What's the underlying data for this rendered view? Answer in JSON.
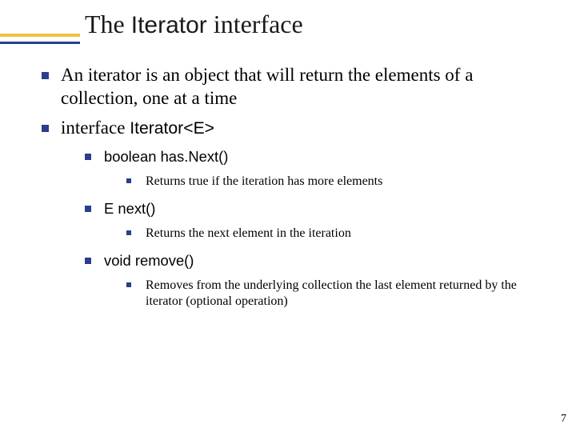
{
  "title": {
    "part1": "The ",
    "code": "Iterator",
    "part2": " interface"
  },
  "b1": "An iterator is an object that will return the elements of a collection, one at a time",
  "b2_pre": "interface ",
  "b2_code": "Iterator<E>",
  "m1": "boolean has.Next()",
  "m1_desc": "Returns true if the iteration has more elements",
  "m2": "E next()",
  "m2_desc": "Returns the next element in the iteration",
  "m3": "void remove()",
  "m3_desc": "Removes from the underlying collection the last element returned by the iterator (optional operation)",
  "page": "7"
}
